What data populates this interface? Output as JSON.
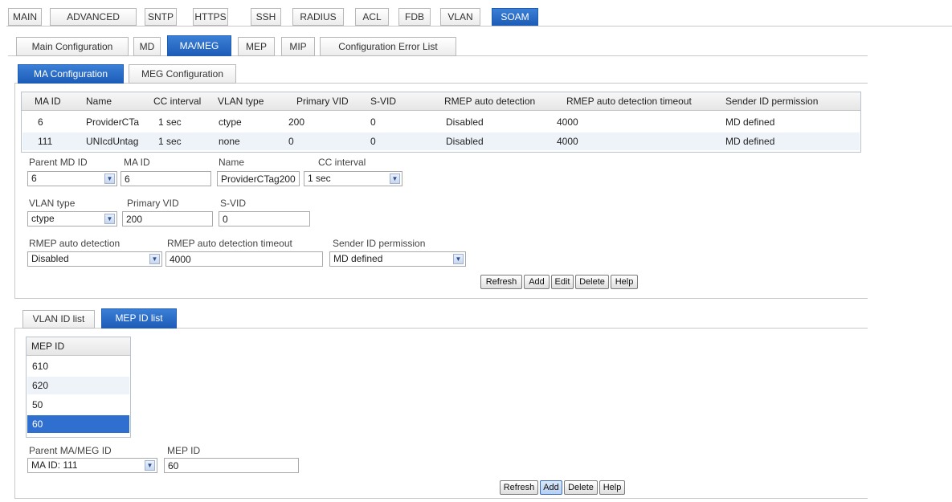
{
  "main_tabs": [
    "MAIN",
    "ADVANCED",
    "SNTP",
    "HTTPS",
    "SSH",
    "RADIUS",
    "ACL",
    "FDB",
    "VLAN",
    "SOAM"
  ],
  "soam_tabs": [
    "Main Configuration",
    "MD",
    "MA/MEG",
    "MEP",
    "MIP",
    "Configuration Error List"
  ],
  "config_tabs": [
    "MA Configuration",
    "MEG Configuration"
  ],
  "ma_table": {
    "headers": [
      "MA ID",
      "Name",
      "CC interval",
      "VLAN type",
      "Primary VID",
      "S-VID",
      "RMEP auto detection",
      "RMEP auto detection timeout",
      "Sender ID permission"
    ],
    "rows": [
      [
        "6",
        "ProviderCTa",
        "1 sec",
        "ctype",
        "200",
        "0",
        "Disabled",
        "4000",
        "MD defined"
      ],
      [
        "111",
        "UNIcdUntag",
        "1 sec",
        "none",
        "0",
        "0",
        "Disabled",
        "4000",
        "MD defined"
      ]
    ]
  },
  "ma_form": {
    "parent_md_label": "Parent MD ID",
    "parent_md_value": "6",
    "ma_id_label": "MA ID",
    "ma_id_value": "6",
    "name_label": "Name",
    "name_value": "ProviderCTag200",
    "cc_label": "CC interval",
    "cc_value": "1 sec",
    "vlan_type_label": "VLAN type",
    "vlan_type_value": "ctype",
    "primary_vid_label": "Primary VID",
    "primary_vid_value": "200",
    "svid_label": "S-VID",
    "svid_value": "0",
    "rmep_label": "RMEP auto detection",
    "rmep_value": "Disabled",
    "rmep_timeout_label": "RMEP auto detection timeout",
    "rmep_timeout_value": "4000",
    "sender_label": "Sender ID permission",
    "sender_value": "MD defined"
  },
  "ma_buttons": [
    "Refresh",
    "Add",
    "Edit",
    "Delete",
    "Help"
  ],
  "list_tabs": [
    "VLAN ID list",
    "MEP ID list"
  ],
  "mep_table": {
    "header": "MEP ID",
    "rows": [
      "610",
      "620",
      "50",
      "60"
    ]
  },
  "mep_form": {
    "parent_label": "Parent MA/MEG ID",
    "parent_value": "MA ID: 111",
    "mep_id_label": "MEP ID",
    "mep_id_value": "60"
  },
  "mep_buttons": [
    "Refresh",
    "Add",
    "Delete",
    "Help"
  ],
  "colors": {
    "accent": "#1d5db8",
    "selected_row": "#2f6fcf",
    "alt_row": "#eef3fa"
  }
}
